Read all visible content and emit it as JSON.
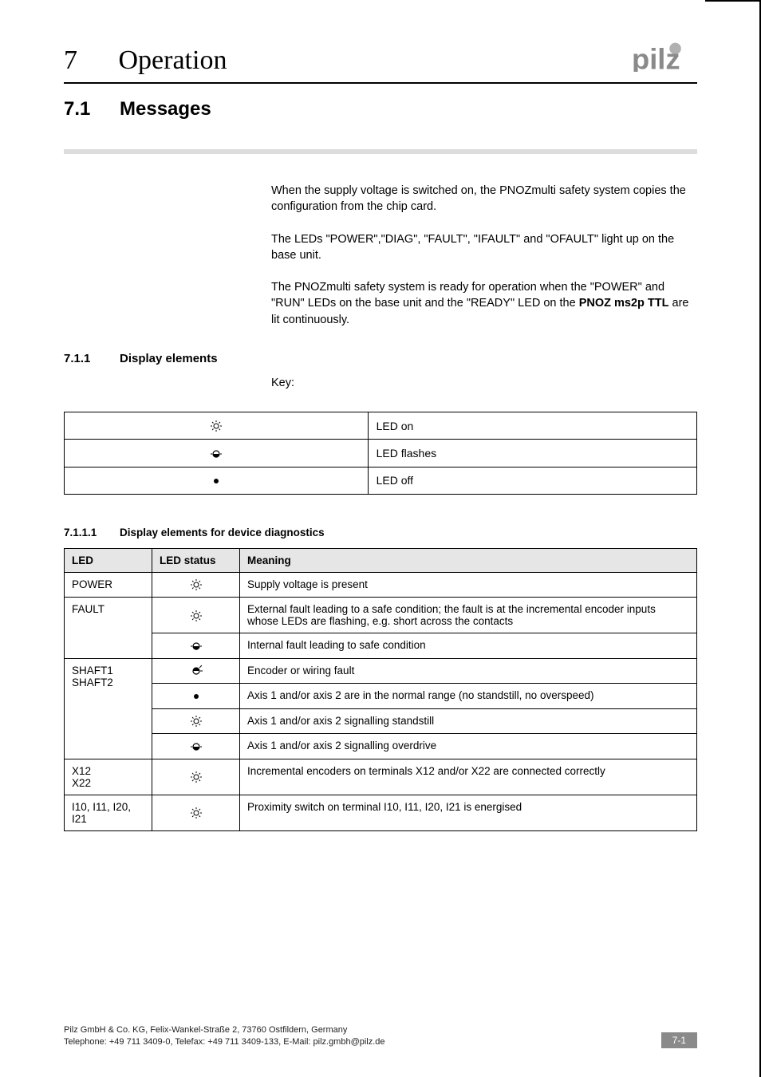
{
  "header": {
    "chapter_number": "7",
    "chapter_title": "Operation",
    "logo_alt": "pilz"
  },
  "section": {
    "number": "7.1",
    "title": "Messages"
  },
  "intro": {
    "p1": "When the supply voltage is switched on, the PNOZmulti safety system copies the configuration from the chip card.",
    "p2": "The LEDs \"POWER\",\"DIAG\", \"FAULT\", \"IFAULT\" and \"OFAULT\" light up on the base unit.",
    "p3_pre": "The PNOZmulti safety system is ready for operation when the \"POWER\" and \"RUN\" LEDs on the base unit and the \"READY\" LED on the ",
    "p3_bold": "PNOZ ms2p TTL",
    "p3_post": " are lit continuously."
  },
  "subsection": {
    "number": "7.1.1",
    "title": "Display elements",
    "key_label": "Key:"
  },
  "key_table": [
    {
      "icon": "led-on",
      "label": "LED on"
    },
    {
      "icon": "led-flashes",
      "label": "LED flashes"
    },
    {
      "icon": "led-off",
      "label": "LED off"
    }
  ],
  "subsubsection": {
    "number": "7.1.1.1",
    "title": "Display elements for device diagnostics"
  },
  "diag_table": {
    "headers": {
      "led": "LED",
      "status": "LED status",
      "meaning": "Meaning"
    },
    "groups": [
      {
        "led": "POWER",
        "rows": [
          {
            "icon": "led-on",
            "meaning": "Supply voltage is present"
          }
        ]
      },
      {
        "led": "FAULT",
        "rows": [
          {
            "icon": "led-on",
            "meaning": "External fault leading to a safe condition; the fault is at the incremental encoder inputs whose LEDs are flashing, e.g. short across the contacts"
          },
          {
            "icon": "led-flashes",
            "meaning": "Internal fault leading to safe condition"
          }
        ]
      },
      {
        "led": "SHAFT1\nSHAFT2",
        "rows": [
          {
            "icon": "led-flashes-alt",
            "meaning": "Encoder or wiring fault"
          },
          {
            "icon": "led-off",
            "meaning": "Axis 1 and/or axis 2 are in the normal range (no standstill, no overspeed)"
          },
          {
            "icon": "led-on",
            "meaning": "Axis 1 and/or axis 2 signalling standstill"
          },
          {
            "icon": "led-flashes",
            "meaning": "Axis 1 and/or axis 2 signalling overdrive"
          }
        ]
      },
      {
        "led": "X12\nX22",
        "rows": [
          {
            "icon": "led-on",
            "meaning": "Incremental encoders on terminals X12 and/or X22 are connected correctly"
          }
        ]
      },
      {
        "led": "I10, I11, I20, I21",
        "rows": [
          {
            "icon": "led-on",
            "meaning": "Proximity switch on terminal I10, I11, I20, I21 is energised"
          }
        ]
      }
    ]
  },
  "footer": {
    "line1": "Pilz GmbH & Co. KG, Felix-Wankel-Straße 2, 73760 Ostfildern, Germany",
    "line2": "Telephone: +49 711 3409-0, Telefax: +49 711 3409-133, E-Mail: pilz.gmbh@pilz.de",
    "page": "7-1"
  }
}
